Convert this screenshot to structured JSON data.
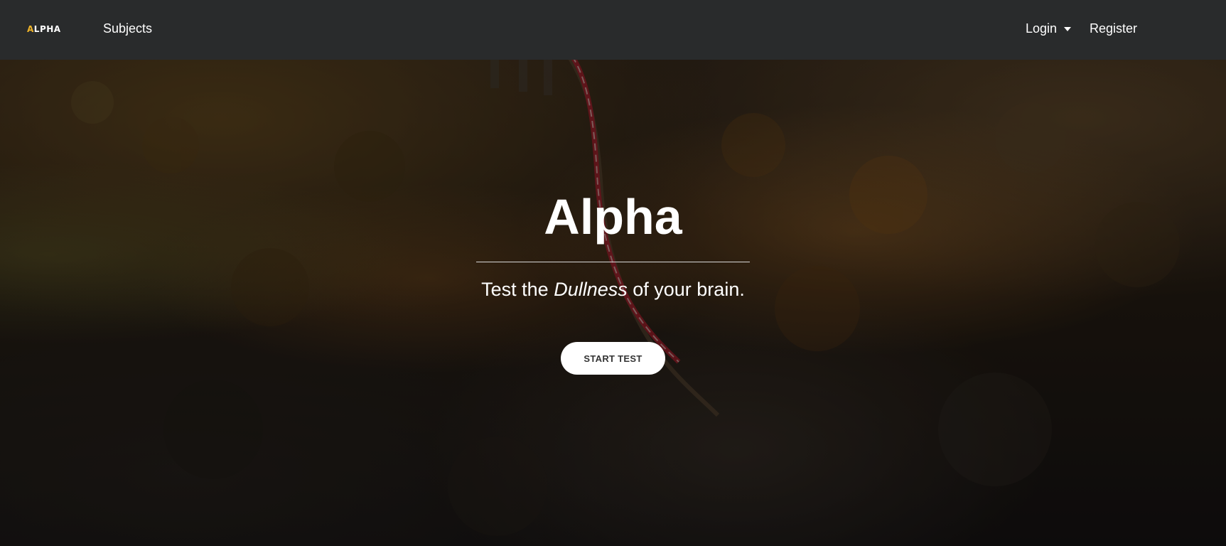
{
  "navbar": {
    "brand": {
      "prefix": "A",
      "rest": "LPHA"
    },
    "subjects_label": "Subjects",
    "login_label": "Login",
    "register_label": "Register"
  },
  "hero": {
    "title": "Alpha",
    "tagline_before": "Test the ",
    "tagline_emphasis": "Dullness",
    "tagline_after": " of your brain.",
    "start_button_label": "START TEST"
  },
  "colors": {
    "navbar_bg": "#292b2c",
    "brand_accent": "#f0b429",
    "button_bg": "#ffffff",
    "text_light": "#ffffff"
  },
  "icons": {
    "login_dropdown": "caret-down-icon"
  }
}
